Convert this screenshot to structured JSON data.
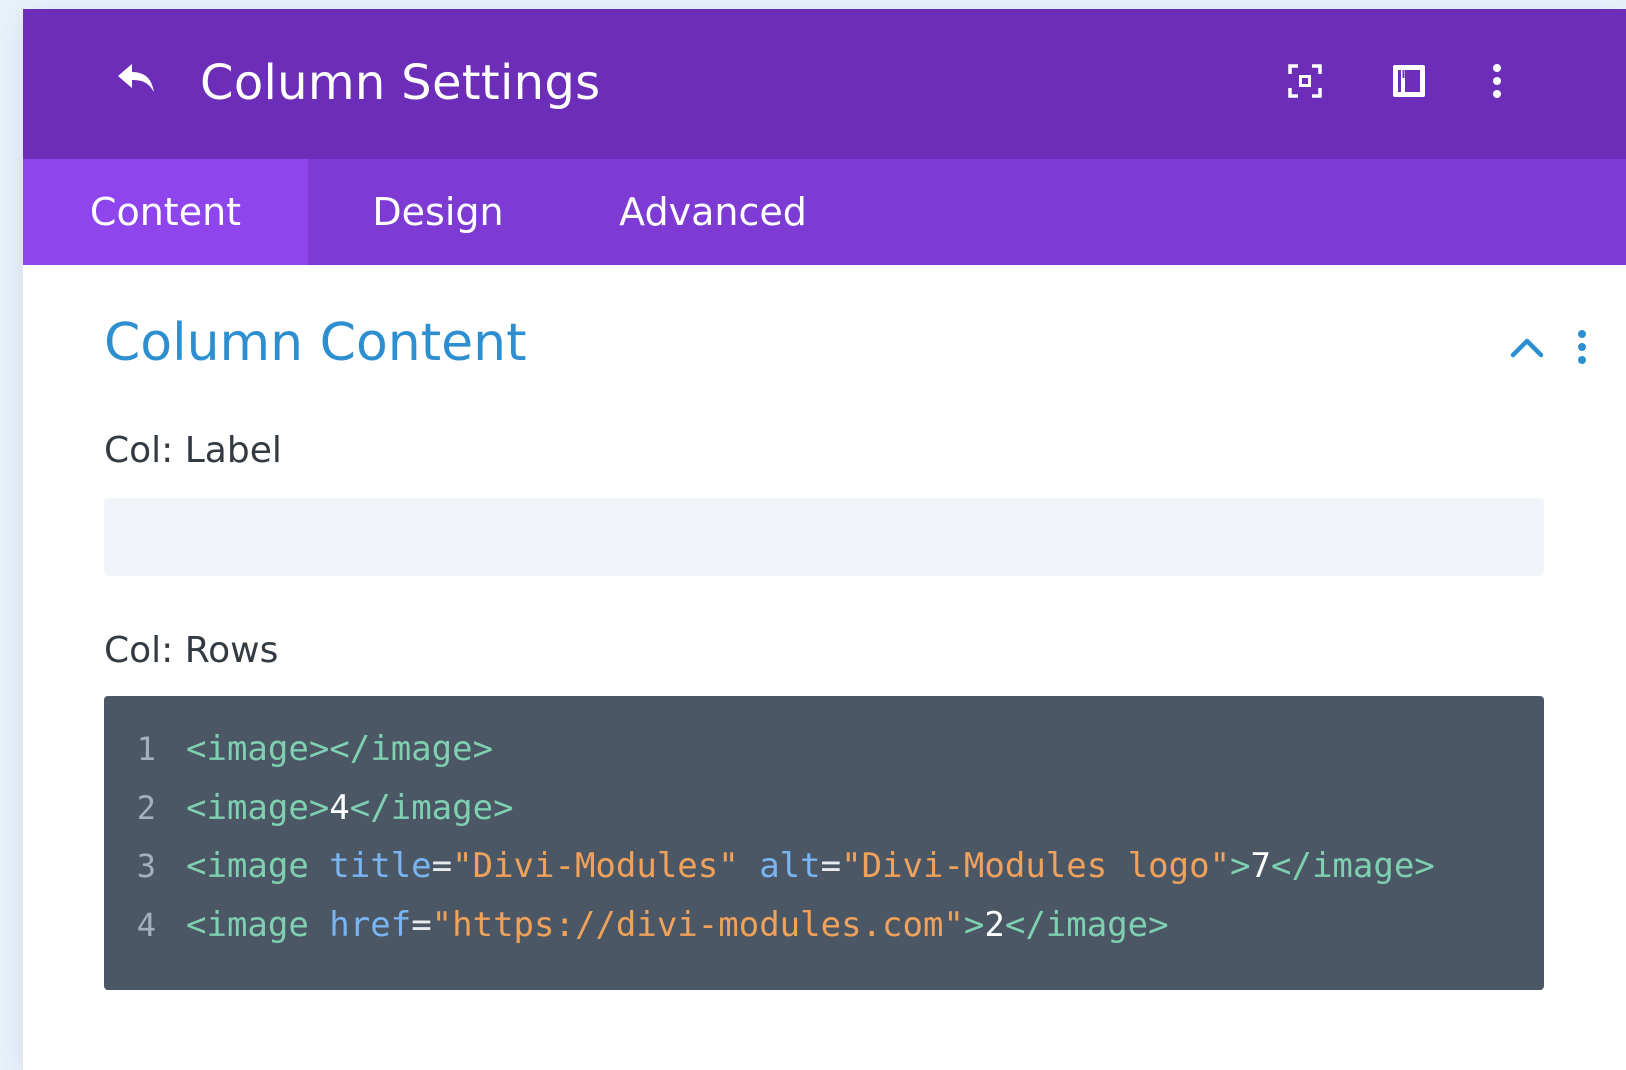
{
  "header": {
    "title": "Column Settings",
    "icons": [
      "back-arrow-icon",
      "focus-mode-icon",
      "split-view-icon",
      "more-options-icon"
    ],
    "bg_color": "#6c2eb9"
  },
  "tabs": [
    {
      "label": "Content",
      "active": true
    },
    {
      "label": "Design",
      "active": false
    },
    {
      "label": "Advanced",
      "active": false
    }
  ],
  "section": {
    "title": "Column Content",
    "accent_color": "#2e8fd0"
  },
  "fields": {
    "label": {
      "label": "Col: Label",
      "value": ""
    },
    "rows": {
      "label": "Col: Rows"
    }
  },
  "code": {
    "line_numbers": [
      "1",
      "2",
      "3",
      "4"
    ],
    "line1": {
      "open": "<image>",
      "close": "</image>"
    },
    "line2": {
      "open": "<image>",
      "text": "4",
      "close": "</image>"
    },
    "line3": {
      "tag_start": "<image ",
      "attr1": "title",
      "eq1": "=",
      "val1": "\"Divi-Modules\"",
      "sp": " ",
      "attr2": "alt",
      "eq2": "=",
      "val2": "\"Divi-Modules logo\"",
      "tag_end": ">",
      "text": "7",
      "close": "</image>"
    },
    "line4": {
      "tag_start": "<image ",
      "attr1": "href",
      "eq1": "=",
      "val1": "\"https://divi-modules.com\"",
      "tag_end": ">",
      "text": "2",
      "close": "</image>"
    }
  }
}
